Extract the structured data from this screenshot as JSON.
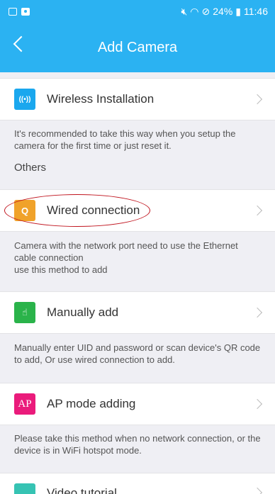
{
  "status_bar": {
    "battery": "24%",
    "time": "11:46"
  },
  "nav": {
    "title": "Add Camera"
  },
  "items": [
    {
      "label": "Wireless Installation",
      "desc": "It's recommended to take this way when you setup the camera for the first time or just reset it.",
      "icon": "wireless-icon",
      "icon_text": "((•))",
      "color": "#1aa7ee"
    },
    {
      "label": "Wired connection",
      "desc": "Camera with the network port need to use the Ethernet cable connection\n use this method to add",
      "icon": "search-icon",
      "icon_text": "Q",
      "color": "#f0a22a"
    },
    {
      "label": "Manually add",
      "desc": "Manually enter UID and password or scan device's QR code to add, Or use wired connection to add.",
      "icon": "hand-tap-icon",
      "icon_text": "☝",
      "color": "#2ab34a"
    },
    {
      "label": "AP mode adding",
      "desc": "Please take this method when no network connection, or the device is in WiFi hotspot mode.",
      "icon": "ap-icon",
      "icon_text": "AP",
      "color": "#ea1b7b"
    },
    {
      "label": "Video tutorial",
      "icon": "graduation-cap-icon",
      "color": "#36c3b3"
    }
  ],
  "section": {
    "others_label": "Others"
  }
}
